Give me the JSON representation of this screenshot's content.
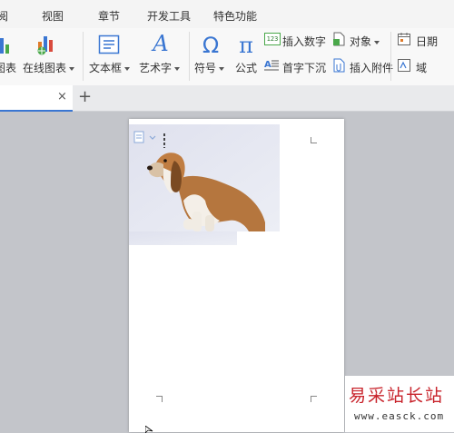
{
  "menubar": {
    "tabs": [
      "阅",
      "视图",
      "章节",
      "开发工具",
      "特色功能"
    ]
  },
  "ribbon": {
    "chart_label": "图表",
    "online_chart_label": "在线图表",
    "textbox_label": "文本框",
    "wordart_label": "艺术字",
    "symbol_label": "符号",
    "formula_label": "公式",
    "insert_number_label": "插入数字",
    "dropcap_label": "首字下沉",
    "object_label": "对象",
    "insert_attachment_label": "插入附件",
    "date_label": "日期",
    "field_label": "域",
    "insert_number_icon_text": "123"
  },
  "tabs": {
    "close_glyph": "×",
    "new_glyph": "+"
  },
  "watermark": {
    "main": "易采站长站",
    "url": "www.easck.com"
  },
  "colors": {
    "accent": "#3a76d2",
    "watermark_red": "#c8232b",
    "workspace": "#c3c5ca"
  }
}
